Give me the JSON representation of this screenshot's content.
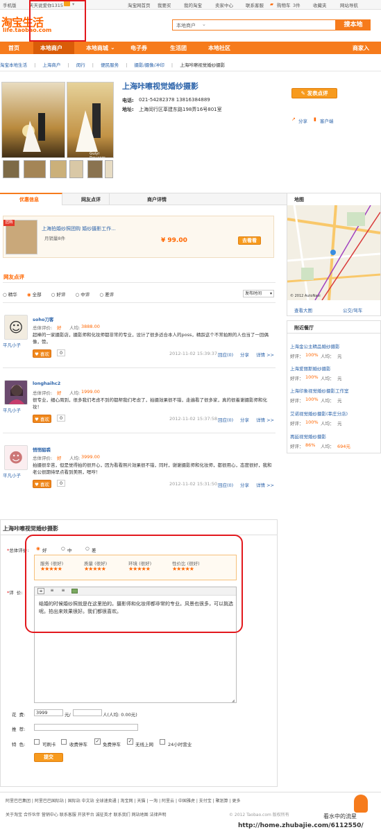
{
  "topbar": {
    "mobile": "手机版",
    "greeting": "天天说爱你1315",
    "links": [
      "淘宝网首页",
      "我要买",
      "我的淘宝",
      "卖家中心",
      "联系客服",
      "购物车",
      "收藏夹",
      "网站导航"
    ],
    "cart_count": "3件"
  },
  "brand": {
    "logo_text": "淘宝生活",
    "logo_url": "life.taobao.com"
  },
  "search": {
    "placeholder": "本地商户",
    "button": "搜本地"
  },
  "nav": {
    "items": [
      "首页",
      "本地商户",
      "本地商城",
      "电子券",
      "生活团",
      "本地社区"
    ],
    "right": "商家入"
  },
  "breadcrumb": [
    "淘宝本地生活",
    "上海商户",
    "闵行",
    "便民服务",
    "摄影/摄像/冲印",
    "上海咔嚓视觉婚纱摄影"
  ],
  "shop": {
    "name": "上海咔嚓视觉婚纱摄影",
    "phone_label": "电话:",
    "phone": "021-54282378   13816384889",
    "addr_label": "地址:",
    "address": "上海闵行区莘建东路198弄16号801室",
    "review_button": "发表点评",
    "share": "分享",
    "client": "客户端",
    "watermark": "Guiyi Rey.com"
  },
  "tabs": [
    "优惠信息",
    "网友点评",
    "商户详情"
  ],
  "deal": {
    "badge": "团购",
    "title": "上海拍婚纱照团购 婚纱摄影工作...",
    "sales": "月销量8件",
    "price": "¥ 99.00",
    "button": "去看看"
  },
  "reviews_header": "网友点评",
  "filters": [
    "精华",
    "全部",
    "好评",
    "中评",
    "差评"
  ],
  "sort": "发布时间",
  "reviews": [
    {
      "user": "soho刀客",
      "rating_label": "总体评价:",
      "rating": "好",
      "per_label": "人均:",
      "per": "3888.00",
      "text": "超棒的一家摄影店，摄影师和化妆师都非常的专业，设计了很多适合本人的poss，精龄这个不常拍照的人也当了一回偶像，赞。",
      "level": "平凡小子",
      "like": "喜欢",
      "like_count": "0",
      "time": "2012-11-02 15:39:37",
      "reply": "回应(0)",
      "share": "分享",
      "detail": "详情 >>"
    },
    {
      "user": "longhaihc2",
      "rating_label": "总体评价:",
      "rating": "好",
      "per_label": "人均:",
      "per": "1999.00",
      "text": "很专业，细心周到，很多我们考虑不到的都帮我们考虑了，拍摄效果很不错，走遍看了很多家，真的很着谢摄影师和化妆！",
      "level": "平凡小子",
      "like": "喜欢",
      "like_count": "0",
      "time": "2012-11-02 15:37:58",
      "reply": "回应(0)",
      "share": "分享",
      "detail": "详情 >>"
    },
    {
      "user": "悄悄貂裘",
      "rating_label": "总体评价:",
      "rating": "好",
      "per_label": "人均:",
      "per": "3999.00",
      "text": "拍摄很辛苦，但是觉得拍的很开心，因为看看照片效果很不错，同时，谢谢摄影师和化妆师，都很用心，态度很好，我和老公很期待早点看到美照，嗯哼！",
      "level": "平凡小子",
      "like": "喜欢",
      "like_count": "0",
      "time": "2012-11-02 15:31:50",
      "reply": "回应(0)",
      "share": "分享",
      "detail": "详情 >>"
    }
  ],
  "map": {
    "title": "地图",
    "view_large": "查看大图",
    "bus": "公交/驾车",
    "copyright": "© 2012 AutoNavi"
  },
  "nearby": {
    "title": "附近餐厅",
    "items": [
      {
        "name": "上海金公主精品婚纱摄影",
        "rating": "好评：",
        "pct": "100%",
        "per": "人均：",
        "val": "元"
      },
      {
        "name": "上海爱丽斯婚纱摄影",
        "rating": "好评：",
        "pct": "100%",
        "per": "人均：",
        "val": "元"
      },
      {
        "name": "上海印象视觉婚纱摄影工作室",
        "rating": "好评：",
        "pct": "100%",
        "per": "人均：",
        "val": "元"
      },
      {
        "name": "艾诺视觉婚纱摄影(莘庄分店)",
        "rating": "好评：",
        "pct": "100%",
        "per": "人均：",
        "val": "元"
      },
      {
        "name": "再延视觉婚纱摄影",
        "rating": "好评：",
        "pct": "86%",
        "per": "人均：",
        "val": "694元"
      }
    ]
  },
  "form": {
    "title": "上海咔嚓视觉婚纱摄影",
    "overall_label": "总体评价:",
    "options": [
      "好",
      "中",
      "差"
    ],
    "subratings": [
      {
        "label": "服务 (很好)",
        "stars": "★★★★★"
      },
      {
        "label": "质量 (很好)",
        "stars": "★★★★★"
      },
      {
        "label": "环境 (很好)",
        "stars": "★★★★★"
      },
      {
        "label": "性价比 (很好)",
        "stars": "★★★★★"
      }
    ],
    "review_label": "评  价:",
    "review_text": "结婚的时候婚纱照就是在这里拍的。摄影师和化妆师都非常的专业。风景也很多，可以挑选呢。拍出来效果很好。我们都很喜欢。",
    "cost_label": "花  费:",
    "cost_value": "3999",
    "cost_unit": "元/",
    "cost_people": "人(人均: 0.00元)",
    "recommend_label": "推  荐:",
    "features_label": "特  色:",
    "features": [
      {
        "label": "可刷卡",
        "checked": false
      },
      {
        "label": "收费停车",
        "checked": false
      },
      {
        "label": "免费停车",
        "checked": true
      },
      {
        "label": "无线上网",
        "checked": true
      },
      {
        "label": "24小时营业",
        "checked": false
      }
    ],
    "submit": "提交"
  },
  "footer": {
    "row1": [
      "阿里巴巴集团",
      "阿里巴巴国际站",
      "国际站",
      "中文站",
      "全球速卖通",
      "淘宝网",
      "天猫",
      "一淘",
      "阿里云",
      "中国雅虎",
      "支付宝",
      "聚划算",
      "更多"
    ],
    "row2": [
      "关于淘宝",
      "合作伙伴",
      "营销中心",
      "联系客服",
      "开放平台",
      "诚征英才",
      "联系我们",
      "网站地图",
      "法律声明"
    ],
    "copyright": "© 2012 Taobao.com 版权所有",
    "watermark1": "看水中的流星",
    "watermark2": "http://home.zhubajie.com/6112550/"
  },
  "colors": {
    "accent": "#f67b1c",
    "link": "#2a62a9",
    "annotation": "#e2171c"
  }
}
